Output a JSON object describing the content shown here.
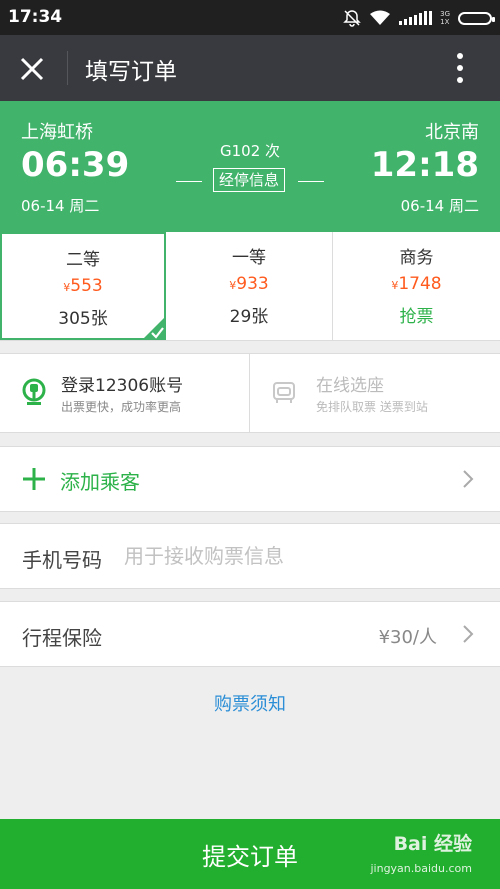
{
  "status_bar": {
    "time": "17:34",
    "network_top": "3G",
    "network_bottom": "1X"
  },
  "nav": {
    "title": "填写订单"
  },
  "train": {
    "code": "G102 次",
    "stops_label": "经停信息",
    "from_station": "上海虹桥",
    "to_station": "北京南",
    "depart_time": "06:39",
    "arrive_time": "12:18",
    "depart_date": "06-14  周二",
    "arrive_date": "06-14  周二"
  },
  "seats": [
    {
      "name": "二等",
      "currency": "¥",
      "price": "553",
      "availability": "305张",
      "selected": true
    },
    {
      "name": "一等",
      "currency": "¥",
      "price": "933",
      "availability": "29张",
      "selected": false
    },
    {
      "name": "商务",
      "currency": "¥",
      "price": "1748",
      "availability": "抢票",
      "selected": false
    }
  ],
  "login": {
    "title": "登录12306账号",
    "subtitle": "出票更快，成功率更高"
  },
  "online_seat": {
    "title": "在线选座",
    "subtitle": "免排队取票 送票到站"
  },
  "add_passenger": {
    "label": "添加乘客"
  },
  "phone": {
    "label": "手机号码",
    "placeholder": "用于接收购票信息",
    "value": ""
  },
  "insurance": {
    "label": "行程保险",
    "value": "¥30/人"
  },
  "purchase_notice": "购票须知",
  "submit": {
    "label": "提交订单"
  },
  "watermark": {
    "text": "Bai 经验",
    "url": "jingyan.baidu.com"
  },
  "colors": {
    "primary_green": "#41b36b",
    "submit_green": "#22ae2e",
    "price_orange": "#ff5b1f",
    "link_blue": "#2b8ed6",
    "nav_bg": "#393a3f"
  }
}
